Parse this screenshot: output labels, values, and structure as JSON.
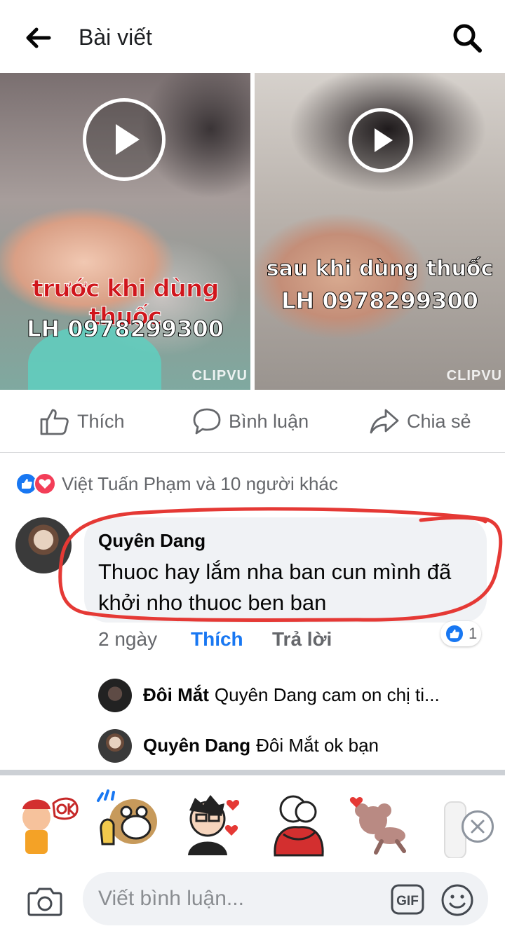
{
  "header": {
    "title": "Bài viết",
    "back_icon": "arrow-left-icon",
    "search_icon": "search-icon"
  },
  "media": {
    "left": {
      "caption_top": "trước khi dùng thuốc",
      "caption_bottom": "LH 0978299300",
      "watermark": "CLIPVU"
    },
    "right": {
      "caption_top": "sau khi dùng thuốc",
      "caption_bottom": "LH 0978299300",
      "watermark": "CLIPVU"
    }
  },
  "actions": {
    "like": "Thích",
    "comment": "Bình luận",
    "share": "Chia sẻ"
  },
  "reactions": {
    "summary": "Việt Tuấn Phạm và 10 người khác"
  },
  "comment": {
    "author": "Quyên Dang",
    "text": "Thuoc hay lắm nha ban cun mình đã khởi nho thuoc ben ban",
    "time": "2 ngày",
    "like_action": "Thích",
    "reply_action": "Trả lời",
    "like_count": "1",
    "accent": "#1877f2"
  },
  "replies": [
    {
      "author": "Đôi Mắt",
      "text": "Quyên Dang  cam on chị ti..."
    },
    {
      "author": "Quyên Dang",
      "text": "Đôi Mắt ok bạn"
    }
  ],
  "composer": {
    "placeholder": "Viết bình luận...",
    "gif_label": "GIF"
  }
}
